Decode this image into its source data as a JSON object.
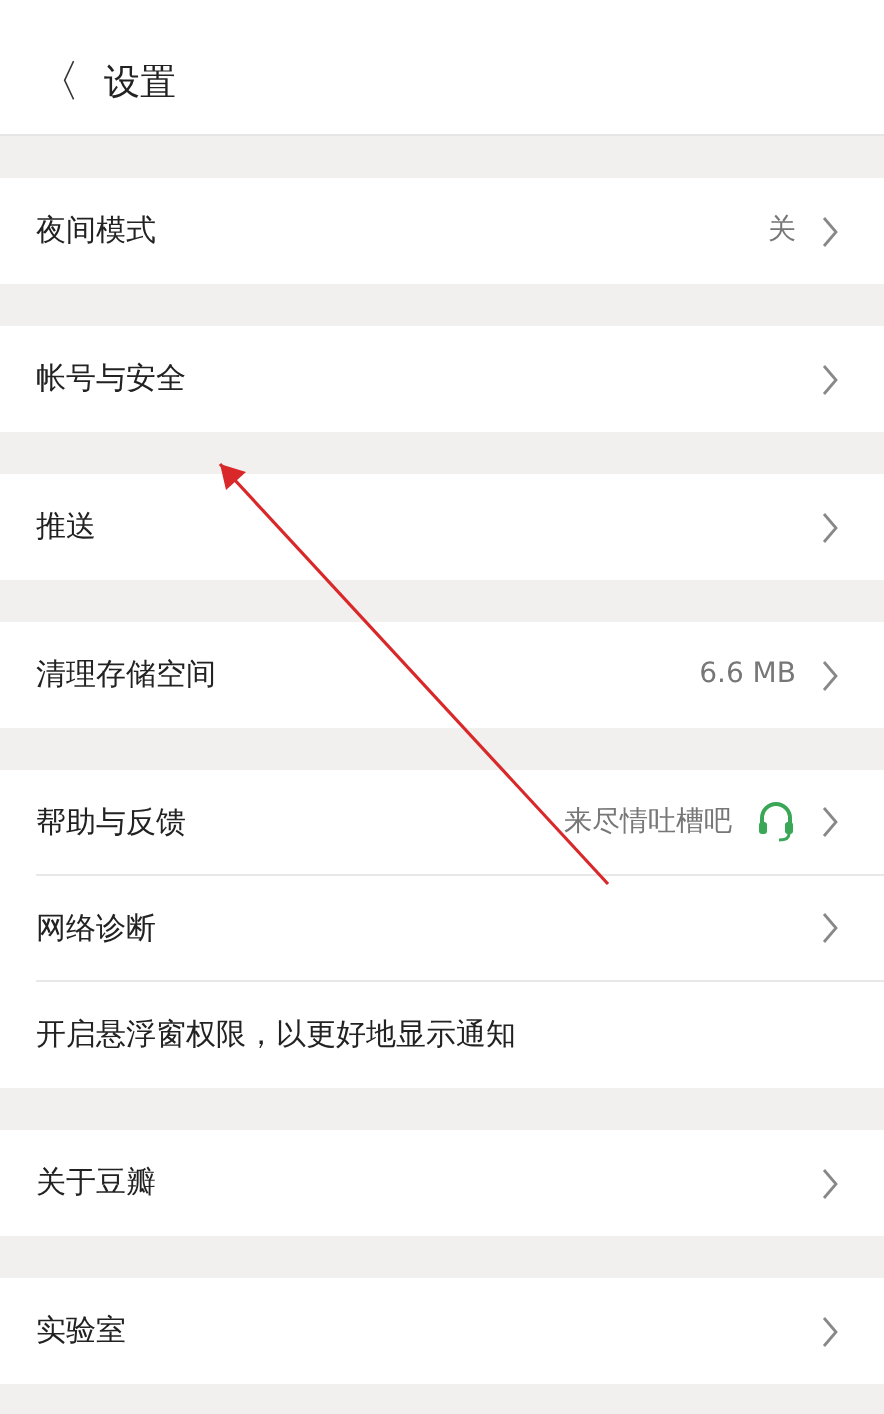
{
  "header": {
    "back": "〈",
    "title": "设置"
  },
  "sections": [
    {
      "rows": [
        {
          "kind": "link",
          "label": "夜间模式",
          "value": "关"
        }
      ]
    },
    {
      "rows": [
        {
          "kind": "link",
          "label": "帐号与安全"
        }
      ]
    },
    {
      "rows": [
        {
          "kind": "link",
          "label": "推送"
        }
      ]
    },
    {
      "rows": [
        {
          "kind": "link",
          "label": "清理存储空间",
          "value": "6.6 MB"
        }
      ]
    },
    {
      "rows": [
        {
          "kind": "feedback",
          "label": "帮助与反馈",
          "value": "来尽情吐槽吧"
        },
        {
          "kind": "link",
          "label": "网络诊断"
        },
        {
          "kind": "plain",
          "label": "开启悬浮窗权限，以更好地显示通知"
        }
      ]
    },
    {
      "rows": [
        {
          "kind": "link",
          "label": "关于豆瓣"
        }
      ]
    },
    {
      "rows": [
        {
          "kind": "link",
          "label": "实验室"
        }
      ]
    }
  ]
}
